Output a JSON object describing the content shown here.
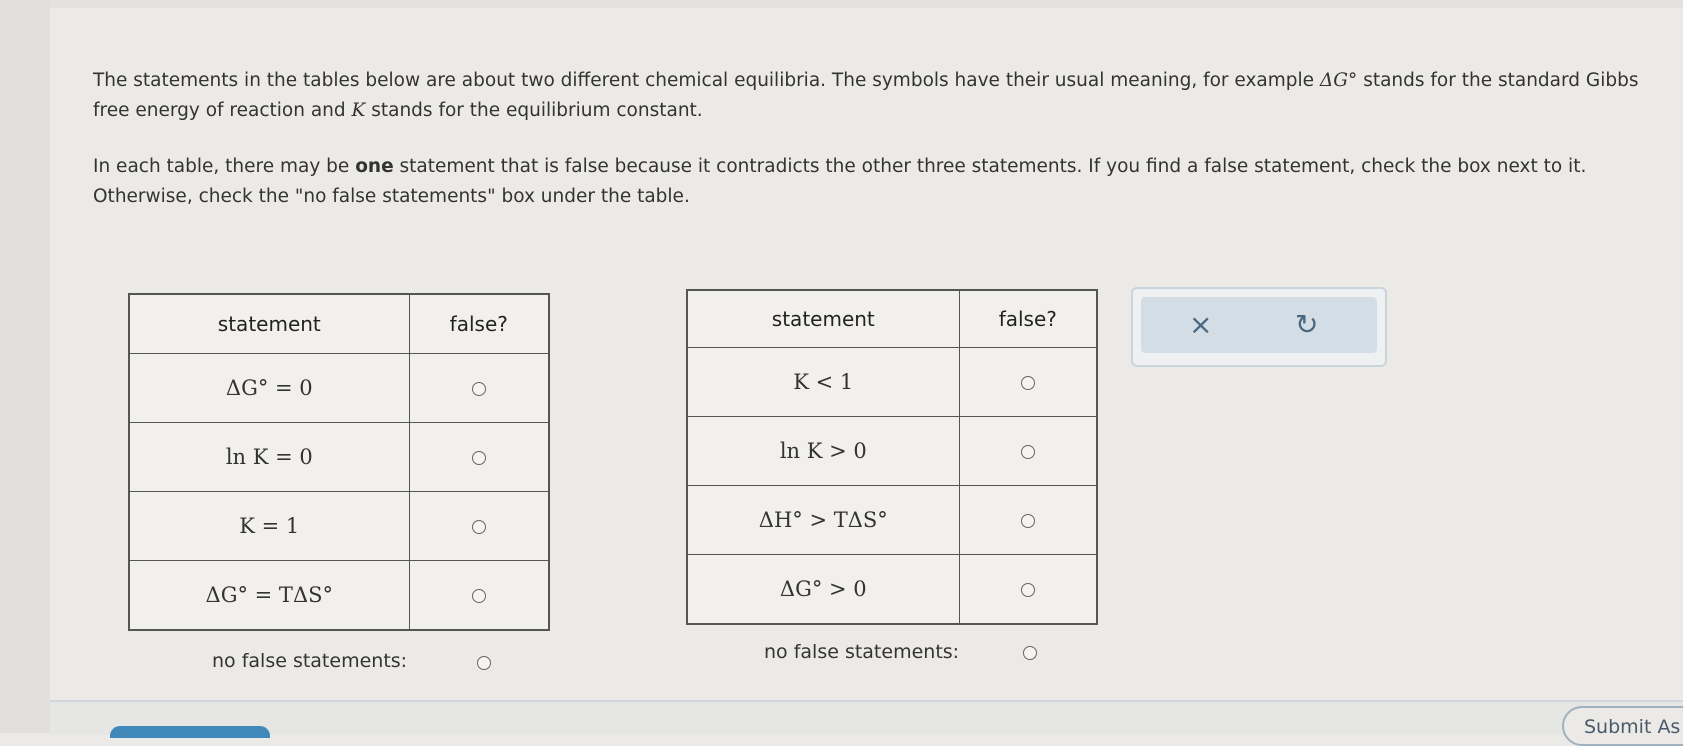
{
  "intro": {
    "p1_a": "The statements in the tables below are about two different chemical equilibria. The symbols have their usual meaning, for example ",
    "p1_math1": "ΔG°",
    "p1_b": " stands for the standard Gibbs free energy of reaction and ",
    "p1_math2": "K",
    "p1_c": " stands for the equilibrium constant.",
    "p2_a": "In each table, there may be ",
    "p2_bold": "one",
    "p2_b": " statement that is false because it contradicts the other three statements. If you find a false statement, check the box next to it. Otherwise, check the \"no false statements\" box under the table."
  },
  "table1": {
    "headers": [
      "statement",
      "false?"
    ],
    "rows": [
      "ΔG° = 0",
      "ln K = 0",
      "K = 1",
      "ΔG° = TΔS°"
    ],
    "no_false_label": "no false statements:"
  },
  "table2": {
    "headers": [
      "statement",
      "false?"
    ],
    "rows": [
      "K < 1",
      "ln K > 0",
      "ΔH° > TΔS°",
      "ΔG° > 0"
    ],
    "no_false_label": "no false statements:"
  },
  "toolbar": {
    "close_icon": "×",
    "undo_icon": "↻"
  },
  "footer": {
    "submit_label": "Submit As"
  }
}
